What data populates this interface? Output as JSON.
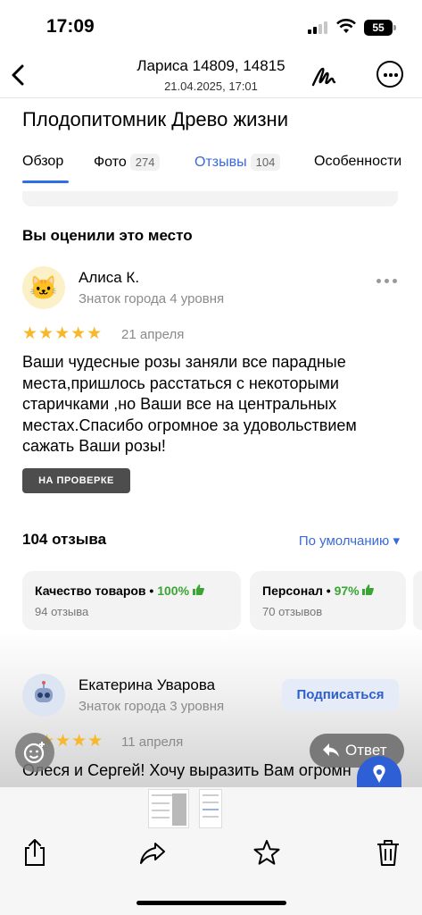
{
  "status_bar": {
    "time": "17:09",
    "battery": "55"
  },
  "header": {
    "title": "Лариса 14809, 14815",
    "subtitle": "21.04.2025, 17:01"
  },
  "page": {
    "org_name": "Плодопитомник Древо жизни",
    "tabs": [
      {
        "label": "Обзор",
        "count": ""
      },
      {
        "label": "Фото",
        "count": "274"
      },
      {
        "label": "Отзывы",
        "count": "104"
      },
      {
        "label": "Особенности",
        "count": ""
      }
    ]
  },
  "my_review": {
    "heading": "Вы оценили это место",
    "author": "Алиса К.",
    "level": "Знаток города 4 уровня",
    "rating": 5,
    "stars": "★★★★★",
    "date": "21 апреля",
    "text": "Ваши чудесные розы заняли все парадные места,пришлось расстаться с некоторыми старичками ,но Ваши все на центральных местах.Спасибо огромное за удовольствием сажать Ваши розы!",
    "status_badge": "НА ПРОВЕРКЕ"
  },
  "reviews": {
    "count_label": "104 отзыва",
    "sort_label": "По умолчанию ▾",
    "aspects": [
      {
        "name": "Качество товаров • ",
        "percent": "100%",
        "thumb": "👍",
        "sub": "94 отзыва"
      },
      {
        "name": "Персонал • ",
        "percent": "97%",
        "thumb": "👍",
        "sub": "70 отзывов"
      }
    ]
  },
  "next_review": {
    "author": "Екатерина Уварова",
    "level": "Знаток города 3 уровня",
    "subscribe_label": "Подписаться",
    "stars": "★★★★",
    "date": "11 апреля",
    "text_visible": "Олеся и Сергей! Хочу выразить Вам огромн"
  },
  "overlay": {
    "reply_label": "Ответ",
    "reply_icon": "reply-arrow-icon",
    "emoji_icon": "emoji-icon"
  },
  "toolbar": {
    "icons": [
      "share-icon",
      "forward-icon",
      "star-icon",
      "trash-icon"
    ]
  },
  "colors": {
    "accent_blue": "#3a6ad8",
    "star_yellow": "#f7b82b",
    "green": "#3aa535",
    "badge_grey": "#4d4d4d"
  }
}
